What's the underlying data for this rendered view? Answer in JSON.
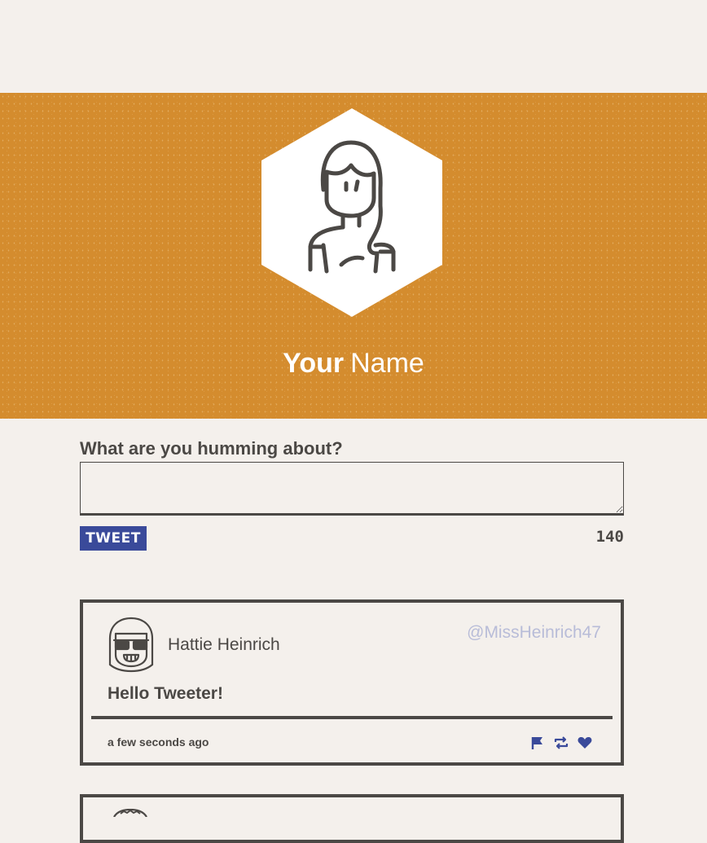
{
  "header": {
    "first_name": "Your",
    "last_name": "Name",
    "background_color": "#d48c2e",
    "avatar_icon": "person-hexagon-avatar"
  },
  "compose": {
    "label": "What are you humming about?",
    "textarea_value": "",
    "button_label": "TWEET",
    "char_count": "140",
    "button_color": "#3a4a9a"
  },
  "tweets": [
    {
      "user_name": "Hattie Heinrich",
      "handle": "@MissHeinrich47",
      "text": "Hello Tweeter!",
      "time": "a few seconds ago",
      "avatar_icon": "sunglasses-avatar",
      "actions": [
        "flag-icon",
        "retweet-icon",
        "heart-icon"
      ],
      "action_color": "#3a4a9a"
    }
  ]
}
